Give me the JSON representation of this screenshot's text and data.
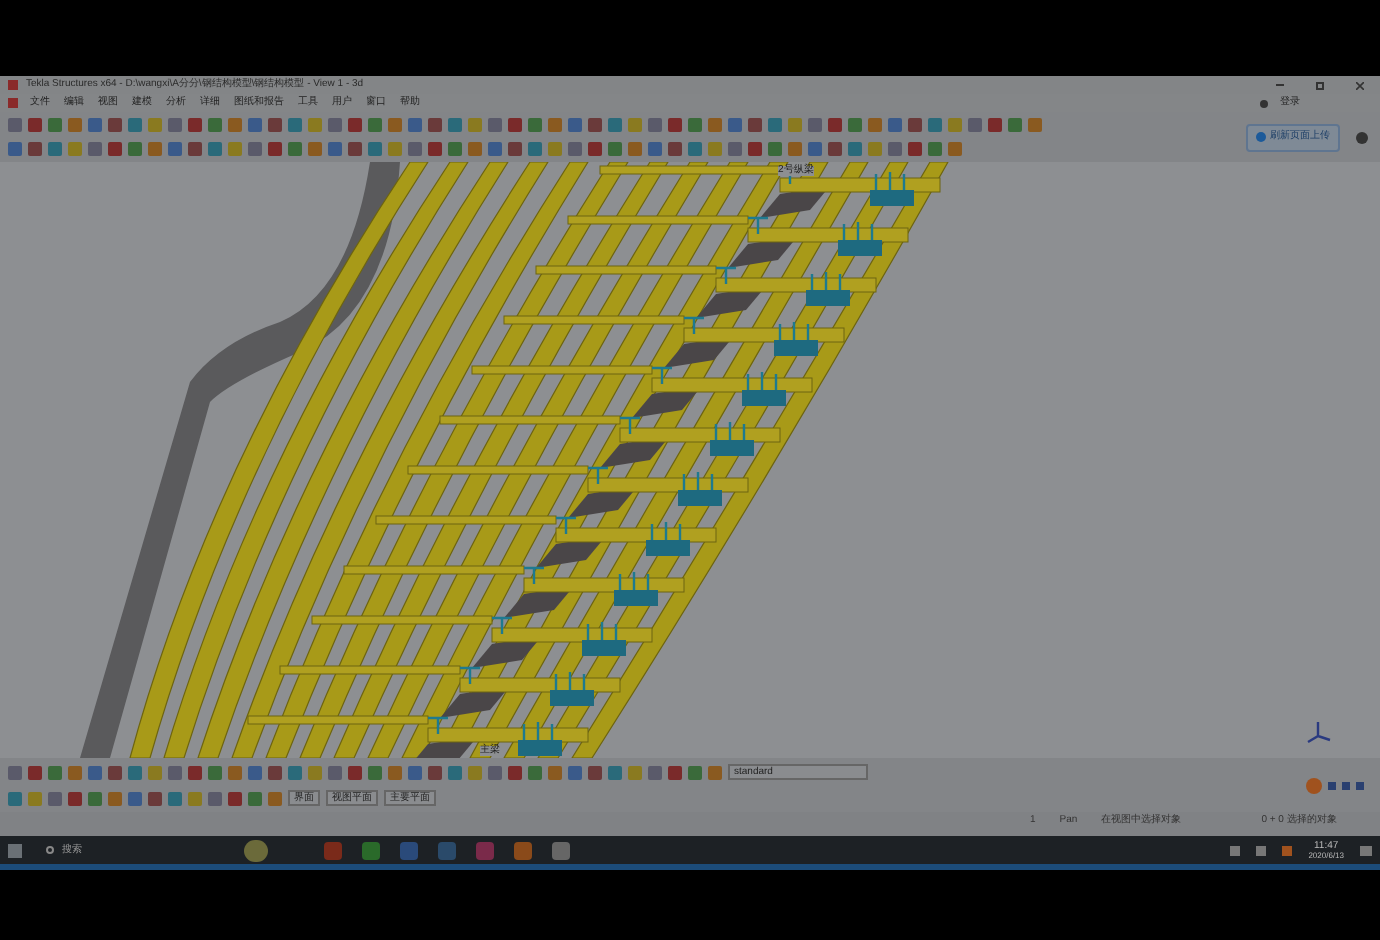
{
  "window": {
    "title": "Tekla Structures x64 - D:\\wangxi\\A分分\\钢结构模型\\钢结构模型 - View 1 - 3d"
  },
  "menu": [
    "文件",
    "编辑",
    "视图",
    "建模",
    "分析",
    "详细",
    "图纸和报告",
    "工具",
    "用户",
    "窗口",
    "帮助"
  ],
  "account": {
    "label": "登录"
  },
  "upload_button": {
    "label": "刷新页面上传"
  },
  "model_labels": [
    {
      "text": "2号纵梁"
    },
    {
      "text": "主梁"
    }
  ],
  "bottom_toolbar": {
    "filter": "standard",
    "dropdowns": [
      "界面",
      "视图平面",
      "主要平面"
    ]
  },
  "status_bar": {
    "count": "1",
    "mode": "Pan",
    "prompt": "在视图中选择对象",
    "selection": "0 + 0 选择的对象"
  },
  "taskbar": {
    "search": "搜索",
    "time": "11:47",
    "date": "2020/6/13"
  }
}
